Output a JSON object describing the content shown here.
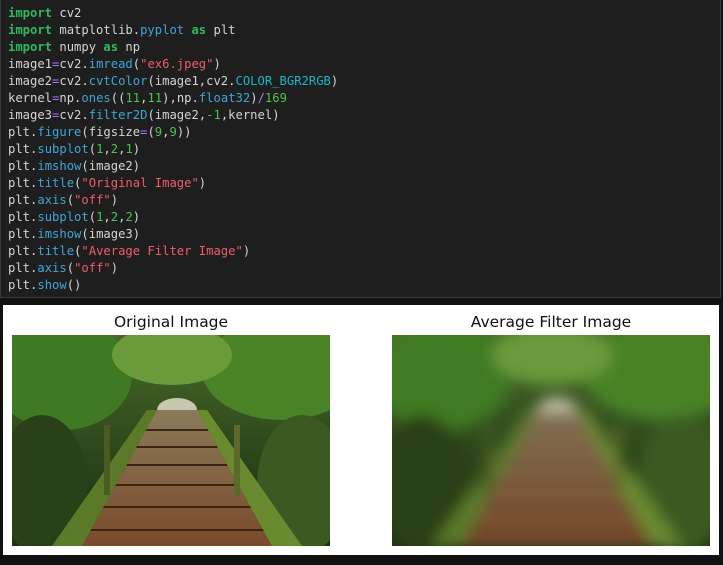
{
  "code": {
    "lines": [
      [
        {
          "t": "import",
          "c": "kw"
        },
        {
          "t": " cv2",
          "c": "plain"
        }
      ],
      [
        {
          "t": "import",
          "c": "kw"
        },
        {
          "t": " matplotlib.",
          "c": "plain"
        },
        {
          "t": "pyplot",
          "c": "fn"
        },
        {
          "t": " ",
          "c": "plain"
        },
        {
          "t": "as",
          "c": "kw"
        },
        {
          "t": " plt",
          "c": "plain"
        }
      ],
      [
        {
          "t": "import",
          "c": "kw"
        },
        {
          "t": " numpy ",
          "c": "plain"
        },
        {
          "t": "as",
          "c": "kw"
        },
        {
          "t": " np",
          "c": "plain"
        }
      ],
      [
        {
          "t": "image1",
          "c": "plain"
        },
        {
          "t": "=",
          "c": "op"
        },
        {
          "t": "cv2.",
          "c": "plain"
        },
        {
          "t": "imread",
          "c": "fn"
        },
        {
          "t": "(",
          "c": "plain"
        },
        {
          "t": "\"ex6.jpeg\"",
          "c": "str"
        },
        {
          "t": ")",
          "c": "plain"
        }
      ],
      [
        {
          "t": "image2",
          "c": "plain"
        },
        {
          "t": "=",
          "c": "op"
        },
        {
          "t": "cv2.",
          "c": "plain"
        },
        {
          "t": "cvtColor",
          "c": "fn"
        },
        {
          "t": "(image1,cv2.",
          "c": "plain"
        },
        {
          "t": "COLOR_BGR2RGB",
          "c": "const"
        },
        {
          "t": ")",
          "c": "plain"
        }
      ],
      [
        {
          "t": "kernel",
          "c": "plain"
        },
        {
          "t": "=",
          "c": "op"
        },
        {
          "t": "np.",
          "c": "plain"
        },
        {
          "t": "ones",
          "c": "fn"
        },
        {
          "t": "((",
          "c": "plain"
        },
        {
          "t": "11",
          "c": "num"
        },
        {
          "t": ",",
          "c": "plain"
        },
        {
          "t": "11",
          "c": "num"
        },
        {
          "t": "),np.",
          "c": "plain"
        },
        {
          "t": "float32",
          "c": "fn"
        },
        {
          "t": ")",
          "c": "plain"
        },
        {
          "t": "/",
          "c": "op"
        },
        {
          "t": "169",
          "c": "num"
        }
      ],
      [
        {
          "t": "image3",
          "c": "plain"
        },
        {
          "t": "=",
          "c": "op"
        },
        {
          "t": "cv2.",
          "c": "plain"
        },
        {
          "t": "filter2D",
          "c": "fn"
        },
        {
          "t": "(image2,",
          "c": "plain"
        },
        {
          "t": "-1",
          "c": "num"
        },
        {
          "t": ",kernel)",
          "c": "plain"
        }
      ],
      [
        {
          "t": "plt.",
          "c": "plain"
        },
        {
          "t": "figure",
          "c": "fn"
        },
        {
          "t": "(figsize",
          "c": "plain"
        },
        {
          "t": "=",
          "c": "op"
        },
        {
          "t": "(",
          "c": "plain"
        },
        {
          "t": "9",
          "c": "num"
        },
        {
          "t": ",",
          "c": "plain"
        },
        {
          "t": "9",
          "c": "num"
        },
        {
          "t": "))",
          "c": "plain"
        }
      ],
      [
        {
          "t": "plt.",
          "c": "plain"
        },
        {
          "t": "subplot",
          "c": "fn"
        },
        {
          "t": "(",
          "c": "plain"
        },
        {
          "t": "1",
          "c": "num"
        },
        {
          "t": ",",
          "c": "plain"
        },
        {
          "t": "2",
          "c": "num"
        },
        {
          "t": ",",
          "c": "plain"
        },
        {
          "t": "1",
          "c": "num"
        },
        {
          "t": ")",
          "c": "plain"
        }
      ],
      [
        {
          "t": "plt.",
          "c": "plain"
        },
        {
          "t": "imshow",
          "c": "fn"
        },
        {
          "t": "(image2)",
          "c": "plain"
        }
      ],
      [
        {
          "t": "plt.",
          "c": "plain"
        },
        {
          "t": "title",
          "c": "fn"
        },
        {
          "t": "(",
          "c": "plain"
        },
        {
          "t": "\"Original Image\"",
          "c": "str"
        },
        {
          "t": ")",
          "c": "plain"
        }
      ],
      [
        {
          "t": "plt.",
          "c": "plain"
        },
        {
          "t": "axis",
          "c": "fn"
        },
        {
          "t": "(",
          "c": "plain"
        },
        {
          "t": "\"off\"",
          "c": "str"
        },
        {
          "t": ")",
          "c": "plain"
        }
      ],
      [
        {
          "t": "plt.",
          "c": "plain"
        },
        {
          "t": "subplot",
          "c": "fn"
        },
        {
          "t": "(",
          "c": "plain"
        },
        {
          "t": "1",
          "c": "num"
        },
        {
          "t": ",",
          "c": "plain"
        },
        {
          "t": "2",
          "c": "num"
        },
        {
          "t": ",",
          "c": "plain"
        },
        {
          "t": "2",
          "c": "num"
        },
        {
          "t": ")",
          "c": "plain"
        }
      ],
      [
        {
          "t": "plt.",
          "c": "plain"
        },
        {
          "t": "imshow",
          "c": "fn"
        },
        {
          "t": "(image3)",
          "c": "plain"
        }
      ],
      [
        {
          "t": "plt.",
          "c": "plain"
        },
        {
          "t": "title",
          "c": "fn"
        },
        {
          "t": "(",
          "c": "plain"
        },
        {
          "t": "\"Average Filter Image\"",
          "c": "str"
        },
        {
          "t": ")",
          "c": "plain"
        }
      ],
      [
        {
          "t": "plt.",
          "c": "plain"
        },
        {
          "t": "axis",
          "c": "fn"
        },
        {
          "t": "(",
          "c": "plain"
        },
        {
          "t": "\"off\"",
          "c": "str"
        },
        {
          "t": ")",
          "c": "plain"
        }
      ],
      [
        {
          "t": "plt.",
          "c": "plain"
        },
        {
          "t": "show",
          "c": "fn"
        },
        {
          "t": "()",
          "c": "plain"
        }
      ]
    ]
  },
  "output": {
    "original_title": "Original Image",
    "filtered_title": "Average Filter Image"
  },
  "colors": {
    "keyword": "#2fb95f",
    "function": "#3da6d8",
    "string": "#f05c6c",
    "number": "#4cc34c",
    "operator": "#b070ff",
    "constant": "#17b7c9"
  }
}
